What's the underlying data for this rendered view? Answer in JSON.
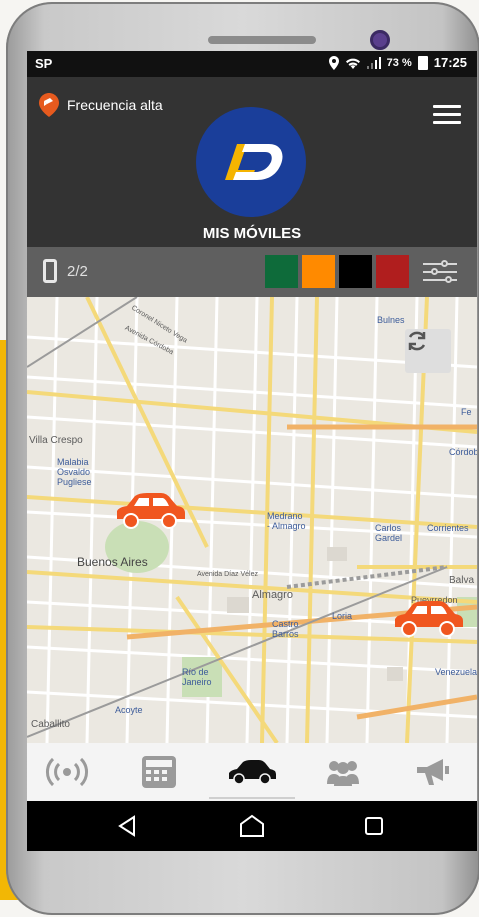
{
  "status_bar": {
    "carrier": "SP",
    "battery_percent": "73 %",
    "time": "17:25"
  },
  "header": {
    "frequency_label": "Frecuencia alta",
    "logo_text": "LD",
    "page_title": "MIS MÓVILES"
  },
  "filter_bar": {
    "device_count": "2/2",
    "color_filters": [
      "#0e6b3a",
      "#ff8a00",
      "#000000",
      "#b01e1e"
    ]
  },
  "map": {
    "labels": {
      "villa_crespo": "Villa Crespo",
      "malabia": "Malabia\nOsvaldo\nPugliese",
      "buenos_aires": "Buenos Aires",
      "medrano": "Medrano\n- Almagro",
      "carlos_gardel": "Carlos\nGardel",
      "corrientes": "Corrientes",
      "almagro": "Almagro",
      "loria": "Loria",
      "castro_barros": "Castro\nBarros",
      "rio_de_janeiro": "Río de\nJaneiro",
      "acoyte": "Acoyte",
      "caballito": "Caballito",
      "venezuela": "Venezuela",
      "pueyrredon": "Pueyrredon",
      "bulnes": "Bulnes",
      "cordoba": "Córdoba",
      "fe": "Fe",
      "balvanera": "Balva",
      "av_diaz_velez": "Avenida Díaz Vélez",
      "av_cordoba": "Avenida Córdoba",
      "scalabrini": "Coronel Niceto Vega"
    },
    "vehicle_color": "#f0561f"
  },
  "bottom_nav": {
    "items": [
      "signal-icon",
      "calculator-icon",
      "car-icon",
      "group-icon",
      "megaphone-icon"
    ],
    "active": "car-icon"
  },
  "android_nav": [
    "back-icon",
    "home-icon",
    "recents-icon"
  ]
}
